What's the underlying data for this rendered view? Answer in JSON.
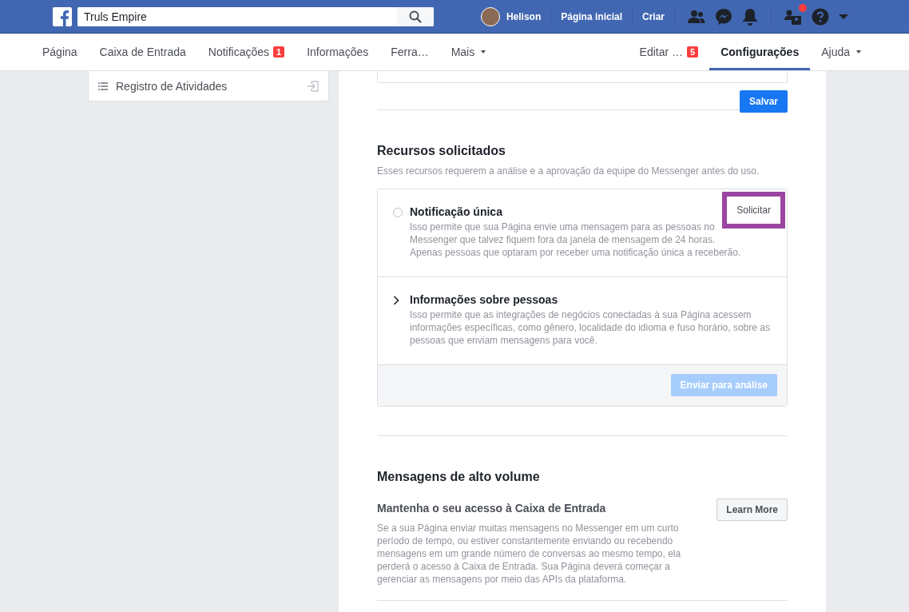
{
  "header": {
    "search": {
      "value": "Truls Empire"
    },
    "user": "Helison",
    "links": [
      "Página inicial",
      "Criar"
    ],
    "friend_requests_dot": true
  },
  "nav": {
    "left": [
      {
        "label": "Página",
        "selected": false
      },
      {
        "label": "Caixa de Entrada",
        "selected": false
      },
      {
        "label": "Notificações",
        "selected": false,
        "badge": "1"
      },
      {
        "label": "Informações",
        "selected": false
      },
      {
        "label": "Ferra…",
        "selected": false
      },
      {
        "label": "Mais",
        "selected": false,
        "dropdown": true
      }
    ],
    "right": [
      {
        "label": "Editar …",
        "selected": false,
        "badge": "5"
      },
      {
        "label": "Configurações",
        "selected": true
      },
      {
        "label": "Ajuda",
        "selected": false,
        "dropdown": true
      }
    ]
  },
  "sidebar": {
    "items": [
      {
        "label": "Registro de Atividades"
      }
    ]
  },
  "save_button": "Salvar",
  "features": {
    "title": "Recursos solicitados",
    "subtitle": "Esses recursos requerem a análise e a aprovação da equipe do Messenger antes do uso.",
    "items": [
      {
        "kind": "radio",
        "title": "Notificação única",
        "description": "Isso permite que sua Página envie uma mensagem para as pessoas no Messenger que talvez fiquem fora da janela de mensagem de 24 horas. Apenas pessoas que optaram por receber uma notificação única a receberão.",
        "checked": false,
        "action": "Solicitar",
        "highlighted": true
      },
      {
        "kind": "expander",
        "title": "Informações sobre pessoas",
        "description": "Isso permite que as integrações de negócios conectadas à sua Página acessem informações específicas, como gênero, localidade do idioma e fuso horário, sobre as pessoas que enviam mensagens para você.",
        "expanded": false
      }
    ],
    "submit": {
      "label": "Enviar para análise",
      "disabled": true
    }
  },
  "high_volume": {
    "title": "Mensagens de alto volume",
    "subtitle": "Mantenha o seu acesso à Caixa de Entrada",
    "description": "Se a sua Página enviar muitas mensagens no Messenger em um curto período de tempo, ou estiver constantemente enviando ou recebendo mensagens em um grande número de conversas ao mesmo tempo, ela perderá o acesso à Caixa de Entrada. Sua Página deverá começar a gerenciar as mensagens por meio das APIs da plataforma.",
    "button": "Learn More"
  }
}
